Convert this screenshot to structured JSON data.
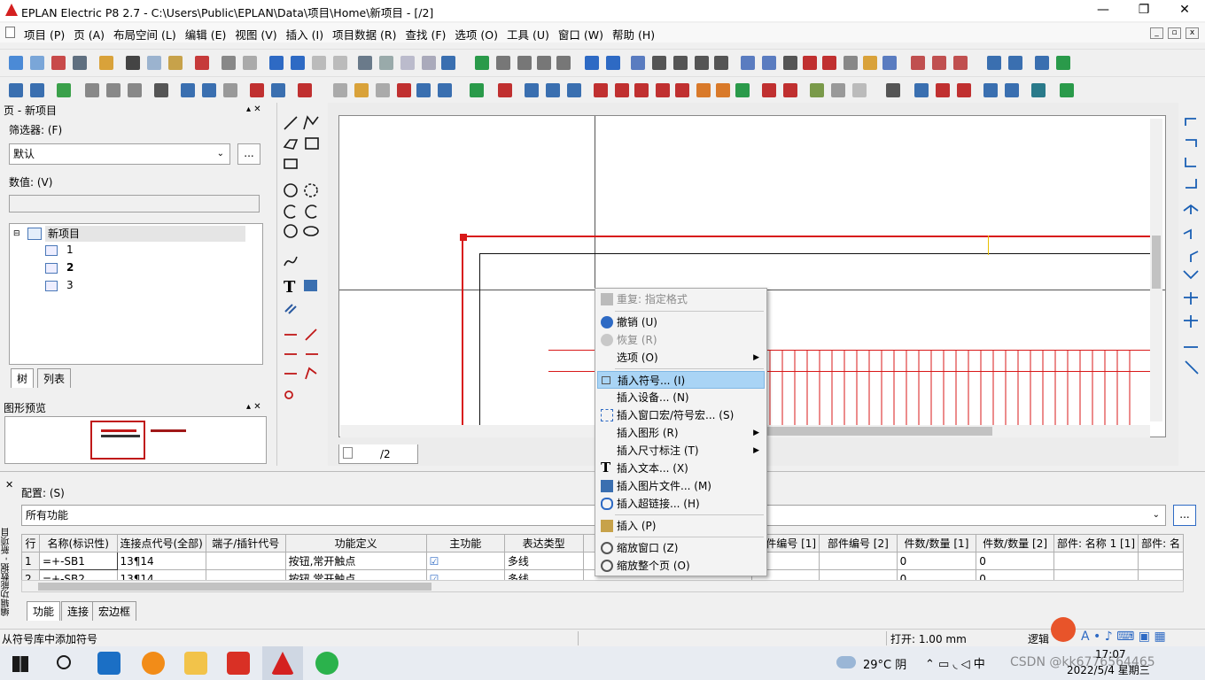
{
  "window": {
    "title": "EPLAN Electric P8 2.7 - C:\\Users\\Public\\EPLAN\\Data\\项目\\Home\\新项目 - [/2]",
    "minimize": "—",
    "maximize": "❐",
    "close": "✕"
  },
  "menu": [
    "项目 (P)",
    "页 (A)",
    "布局空间 (L)",
    "编辑 (E)",
    "视图 (V)",
    "插入 (I)",
    "项目数据 (R)",
    "查找 (F)",
    "选项 (O)",
    "工具 (U)",
    "窗口 (W)",
    "帮助 (H)"
  ],
  "page_panel": {
    "title": "页 - 新项目",
    "filter_label": "筛选器: (F)",
    "filter_value": "默认",
    "value_label": "数值: (V)",
    "value_text": "",
    "ellipsis": "...",
    "tree_root": "新项目",
    "tree_pages": [
      "1",
      "2",
      "3"
    ],
    "tabs": [
      "树",
      "列表"
    ],
    "pin": "▴ ✕"
  },
  "preview_panel": {
    "title": "图形预览"
  },
  "canvas": {
    "page_tab": "/2"
  },
  "context_menu": [
    {
      "label": "重复: 指定格式",
      "disabled": true,
      "icon": "brush-icon"
    },
    {
      "sep": true
    },
    {
      "label": "撤销 (U)",
      "icon": "undo-icon"
    },
    {
      "label": "恢复 (R)",
      "disabled": true,
      "icon": "redo-icon"
    },
    {
      "label": "选项 (O)",
      "submenu": true
    },
    {
      "sep": true
    },
    {
      "label": "插入符号... (I)",
      "highlight": true,
      "icon": "symbol-icon"
    },
    {
      "label": "插入设备... (N)"
    },
    {
      "label": "插入窗口宏/符号宏... (S)",
      "icon": "macro-icon"
    },
    {
      "label": "插入图形 (R)",
      "submenu": true
    },
    {
      "label": "插入尺寸标注 (T)",
      "submenu": true
    },
    {
      "label": "插入文本... (X)",
      "icon": "text-icon"
    },
    {
      "label": "插入图片文件... (M)",
      "icon": "image-icon"
    },
    {
      "label": "插入超链接... (H)",
      "icon": "link-icon"
    },
    {
      "sep": true
    },
    {
      "label": "插入 (P)",
      "icon": "paste-icon"
    },
    {
      "sep": true
    },
    {
      "label": "缩放窗口 (Z)",
      "icon": "zoom-window-icon"
    },
    {
      "label": "缩放整个页 (O)",
      "icon": "zoom-page-icon"
    }
  ],
  "bottom_panel": {
    "side_title": "编辑功能数据 - 新项目",
    "config_label": "配置: (S)",
    "config_value": "所有功能",
    "columns": [
      "行",
      "名称(标识性)",
      "连接点代号(全部)",
      "端子/插针代号",
      "功能定义",
      "主功能",
      "表达类型",
      "",
      "部件编号 [1]",
      "部件编号 [2]",
      "件数/数量 [1]",
      "件数/数量 [2]",
      "部件: 名称 1 [1]",
      "部件: 名"
    ],
    "rows": [
      [
        "1",
        "=+-SB1",
        "13¶14",
        "",
        "按钮,常开触点",
        "☑",
        "多线",
        "",
        "",
        "",
        "0",
        "0",
        "",
        ""
      ],
      [
        "2",
        "=+-SB2",
        "13¶14",
        "",
        "按钮,常开触点",
        "☑",
        "多线",
        "",
        "",
        "",
        "0",
        "0",
        "",
        ""
      ]
    ],
    "tabs": [
      "功能",
      "连接",
      "宏边框"
    ]
  },
  "status": {
    "hint": "从符号库中添加符号",
    "open": "打开: 1.00 mm",
    "logic": "逻辑"
  },
  "taskbar": {
    "weather": "29°C 阴",
    "time": "17:07",
    "date": "2022/5/4 星期三",
    "watermark": "CSDN @kk6776564465"
  }
}
